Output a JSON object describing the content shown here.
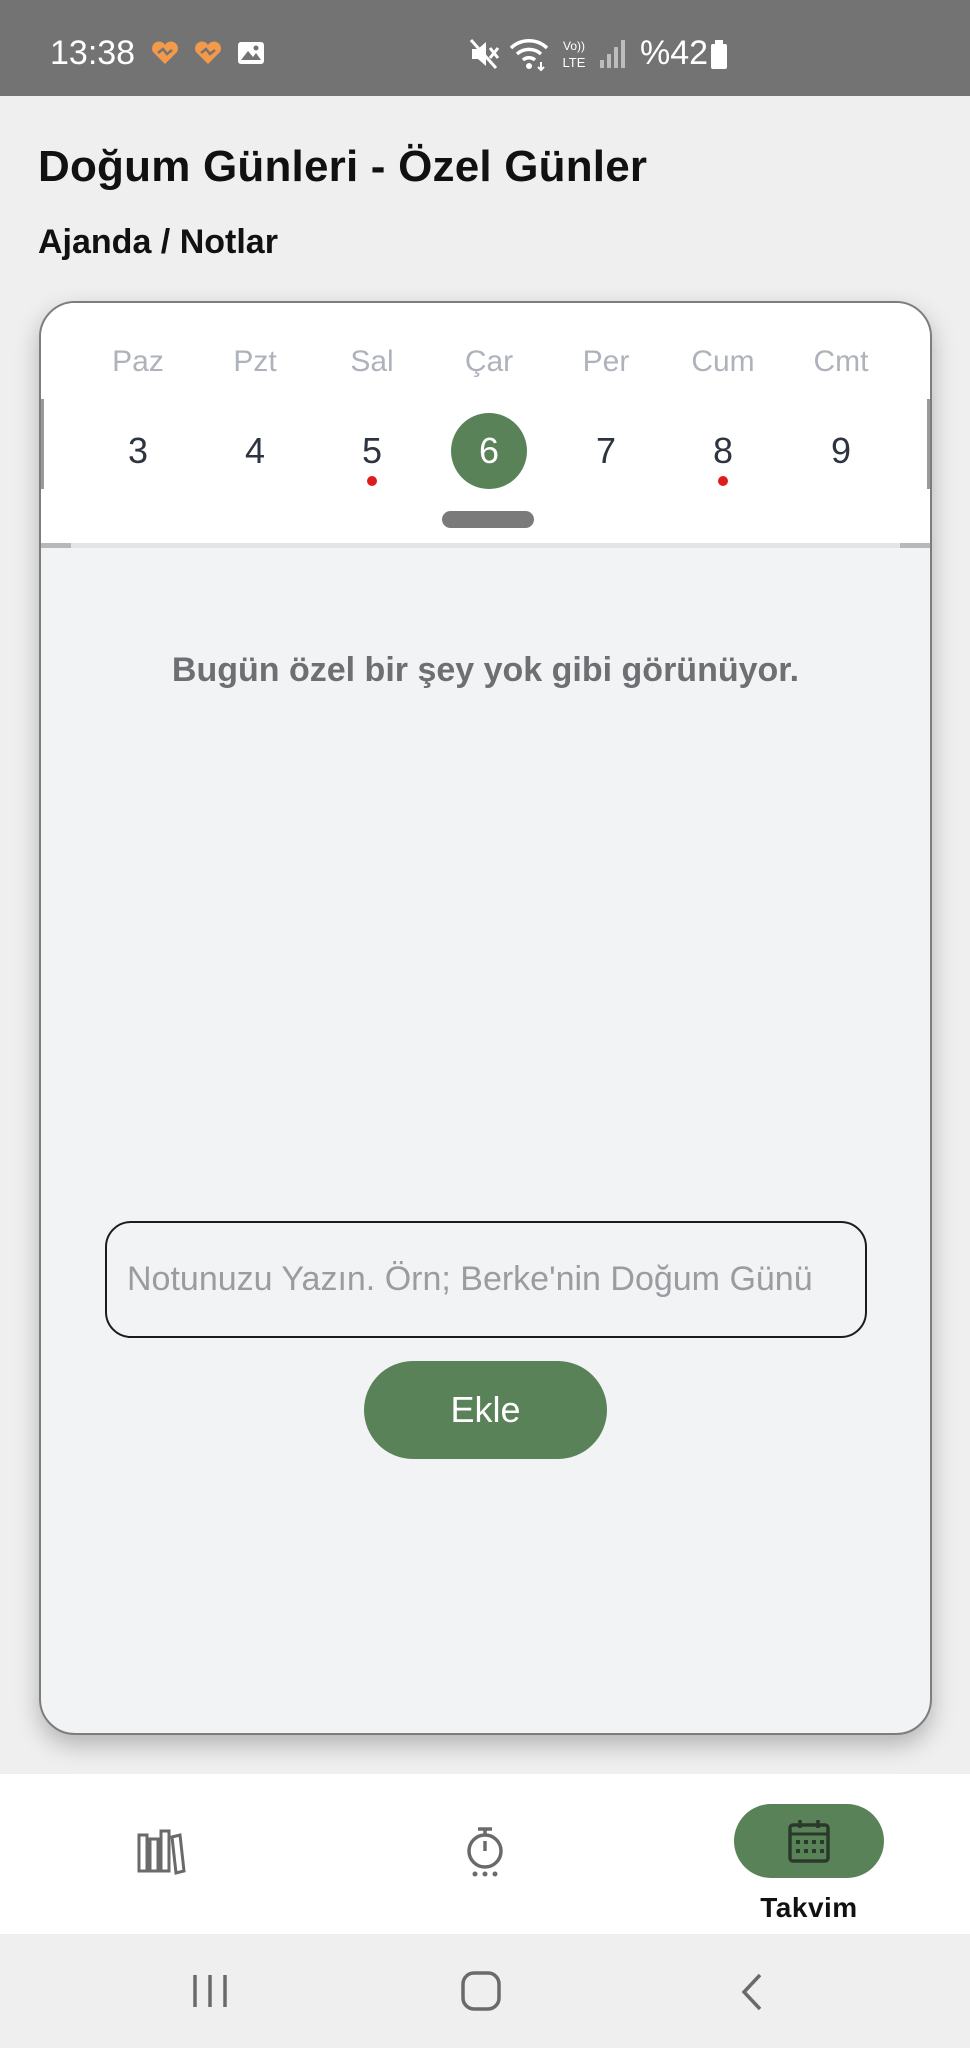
{
  "status_bar": {
    "time": "13:38",
    "battery_text": "%42",
    "icons": [
      "heart-notif-icon",
      "heart-notif-icon",
      "image-notif-icon",
      "mute-icon",
      "wifi-icon",
      "volte-icon",
      "signal-icon",
      "battery-icon"
    ]
  },
  "header": {
    "title": "Doğum Günleri - Özel Günler",
    "subtitle": "Ajanda / Notlar"
  },
  "calendar": {
    "days": [
      {
        "name": "Paz",
        "number": "3",
        "has_event": false,
        "selected": false
      },
      {
        "name": "Pzt",
        "number": "4",
        "has_event": false,
        "selected": false
      },
      {
        "name": "Sal",
        "number": "5",
        "has_event": true,
        "selected": false
      },
      {
        "name": "Çar",
        "number": "6",
        "has_event": false,
        "selected": true
      },
      {
        "name": "Per",
        "number": "7",
        "has_event": false,
        "selected": false
      },
      {
        "name": "Cum",
        "number": "8",
        "has_event": true,
        "selected": false
      },
      {
        "name": "Cmt",
        "number": "9",
        "has_event": false,
        "selected": false
      }
    ],
    "empty_message": "Bugün özel bir şey yok gibi görünüyor."
  },
  "note_form": {
    "placeholder": "Notunuzu Yazın. Örn; Berke'nin Doğum Günü",
    "value": "",
    "add_label": "Ekle"
  },
  "bottom_nav": {
    "items": [
      {
        "icon": "library-icon",
        "label": "",
        "active": false
      },
      {
        "icon": "timer-icon",
        "label": "",
        "active": false
      },
      {
        "icon": "calendar-icon",
        "label": "Takvim",
        "active": true
      }
    ]
  },
  "system_nav": {
    "icons": [
      "recent-apps-icon",
      "home-icon",
      "back-icon"
    ]
  },
  "colors": {
    "accent": "#5a8259",
    "event_dot": "#e01b1b",
    "status_bar": "#737373"
  }
}
